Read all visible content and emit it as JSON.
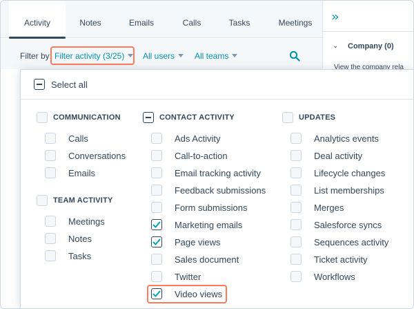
{
  "tabs": [
    {
      "label": "Activity",
      "active": true
    },
    {
      "label": "Notes"
    },
    {
      "label": "Emails"
    },
    {
      "label": "Calls"
    },
    {
      "label": "Tasks"
    },
    {
      "label": "Meetings"
    }
  ],
  "filter": {
    "label": "Filter by:",
    "activity": "Filter activity (3/25)",
    "users": "All users",
    "teams": "All teams"
  },
  "right_panel": {
    "company": "Company (0)",
    "text": "View the company rela"
  },
  "dropdown": {
    "select_all": "Select all",
    "groups": {
      "communication": {
        "title": "COMMUNICATION",
        "items": [
          "Calls",
          "Conversations",
          "Emails"
        ]
      },
      "team_activity": {
        "title": "TEAM ACTIVITY",
        "items": [
          "Meetings",
          "Notes",
          "Tasks"
        ]
      },
      "contact_activity": {
        "title": "CONTACT ACTIVITY",
        "items": [
          "Ads Activity",
          "Call-to-action",
          "Email tracking activity",
          "Feedback submissions",
          "Form submissions",
          "Marketing emails",
          "Page views",
          "Sales document",
          "Twitter",
          "Video views"
        ],
        "checked": [
          "Marketing emails",
          "Page views",
          "Video views"
        ]
      },
      "updates": {
        "title": "UPDATES",
        "items": [
          "Analytics events",
          "Deal activity",
          "Lifecycle changes",
          "List memberships",
          "Merges",
          "Salesforce syncs",
          "Sequences activity",
          "Ticket activity",
          "Workflows"
        ]
      }
    }
  },
  "colors": {
    "accent": "#0091ae",
    "highlight": "#ff7a59",
    "text": "#33475b"
  }
}
